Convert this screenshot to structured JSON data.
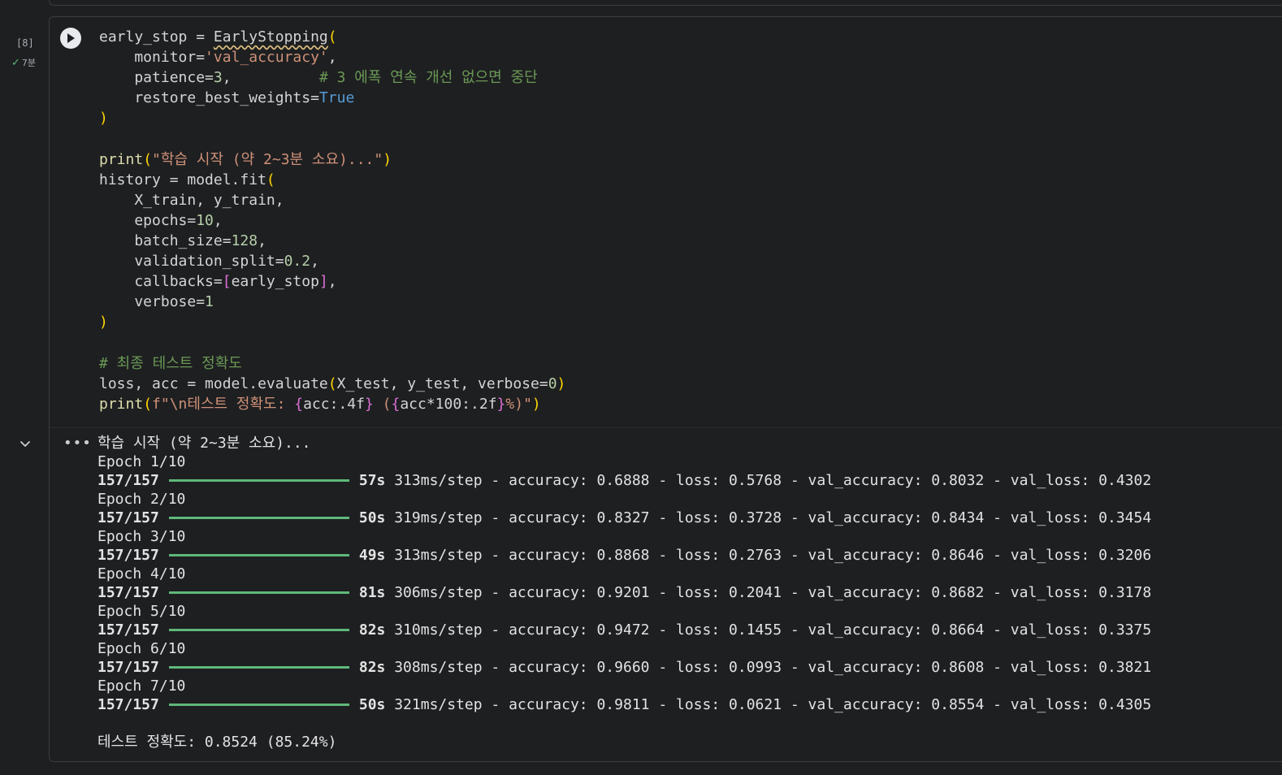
{
  "cell": {
    "execution_count": "[8]",
    "status_time": "7분"
  },
  "code_lines": [
    [
      {
        "t": "early_stop = "
      },
      {
        "t": "EarlyStopping",
        "c": "cls"
      },
      {
        "t": "(",
        "c": "br"
      }
    ],
    [
      {
        "t": "    monitor="
      },
      {
        "t": "'val_accuracy'",
        "c": "str"
      },
      {
        "t": ","
      }
    ],
    [
      {
        "t": "    patience="
      },
      {
        "t": "3",
        "c": "num"
      },
      {
        "t": ",          "
      },
      {
        "t": "# 3 에폭 연속 개선 없으면 중단",
        "c": "cm"
      }
    ],
    [
      {
        "t": "    restore_best_weights="
      },
      {
        "t": "True",
        "c": "kw"
      }
    ],
    [
      {
        "t": ")",
        "c": "br"
      }
    ],
    [
      {
        "t": ""
      }
    ],
    [
      {
        "t": "print",
        "c": "fn"
      },
      {
        "t": "(",
        "c": "br"
      },
      {
        "t": "\"학습 시작 (약 2~3분 소요)...\"",
        "c": "str"
      },
      {
        "t": ")",
        "c": "br"
      }
    ],
    [
      {
        "t": "history = model.fit"
      },
      {
        "t": "(",
        "c": "br"
      }
    ],
    [
      {
        "t": "    X_train, y_train,"
      }
    ],
    [
      {
        "t": "    epochs="
      },
      {
        "t": "10",
        "c": "num"
      },
      {
        "t": ","
      }
    ],
    [
      {
        "t": "    batch_size="
      },
      {
        "t": "128",
        "c": "num"
      },
      {
        "t": ","
      }
    ],
    [
      {
        "t": "    validation_split="
      },
      {
        "t": "0.2",
        "c": "num"
      },
      {
        "t": ","
      }
    ],
    [
      {
        "t": "    callbacks="
      },
      {
        "t": "[",
        "c": "br2"
      },
      {
        "t": "early_stop"
      },
      {
        "t": "]",
        "c": "br2"
      },
      {
        "t": ","
      }
    ],
    [
      {
        "t": "    verbose="
      },
      {
        "t": "1",
        "c": "num"
      }
    ],
    [
      {
        "t": ")",
        "c": "br"
      }
    ],
    [
      {
        "t": ""
      }
    ],
    [
      {
        "t": "# 최종 테스트 정확도",
        "c": "cm"
      }
    ],
    [
      {
        "t": "loss, acc = model.evaluate"
      },
      {
        "t": "(",
        "c": "br"
      },
      {
        "t": "X_test, y_test, verbose="
      },
      {
        "t": "0",
        "c": "num"
      },
      {
        "t": ")",
        "c": "br"
      }
    ],
    [
      {
        "t": "print",
        "c": "fn"
      },
      {
        "t": "(",
        "c": "br"
      },
      {
        "t": "f\"\\n테스트 정확도: ",
        "c": "str"
      },
      {
        "t": "{",
        "c": "br2"
      },
      {
        "t": "acc:.4f"
      },
      {
        "t": "}",
        "c": "br2"
      },
      {
        "t": " (",
        "c": "str"
      },
      {
        "t": "{",
        "c": "br2"
      },
      {
        "t": "acc*100:.2f"
      },
      {
        "t": "}",
        "c": "br2"
      },
      {
        "t": "%)\"",
        "c": "str"
      },
      {
        "t": ")",
        "c": "br"
      }
    ]
  ],
  "output": {
    "header": "학습 시작 (약 2~3분 소요)...",
    "epochs": [
      {
        "epoch": "Epoch 1/10",
        "steps": "157/157",
        "time": "57s",
        "rest": "313ms/step - accuracy: 0.6888 - loss: 0.5768 - val_accuracy: 0.8032 - val_loss: 0.4302"
      },
      {
        "epoch": "Epoch 2/10",
        "steps": "157/157",
        "time": "50s",
        "rest": "319ms/step - accuracy: 0.8327 - loss: 0.3728 - val_accuracy: 0.8434 - val_loss: 0.3454"
      },
      {
        "epoch": "Epoch 3/10",
        "steps": "157/157",
        "time": "49s",
        "rest": "313ms/step - accuracy: 0.8868 - loss: 0.2763 - val_accuracy: 0.8646 - val_loss: 0.3206"
      },
      {
        "epoch": "Epoch 4/10",
        "steps": "157/157",
        "time": "81s",
        "rest": "306ms/step - accuracy: 0.9201 - loss: 0.2041 - val_accuracy: 0.8682 - val_loss: 0.3178"
      },
      {
        "epoch": "Epoch 5/10",
        "steps": "157/157",
        "time": "82s",
        "rest": "310ms/step - accuracy: 0.9472 - loss: 0.1455 - val_accuracy: 0.8664 - val_loss: 0.3375"
      },
      {
        "epoch": "Epoch 6/10",
        "steps": "157/157",
        "time": "82s",
        "rest": "308ms/step - accuracy: 0.9660 - loss: 0.0993 - val_accuracy: 0.8608 - val_loss: 0.3821"
      },
      {
        "epoch": "Epoch 7/10",
        "steps": "157/157",
        "time": "50s",
        "rest": "321ms/step - accuracy: 0.9811 - loss: 0.0621 - val_accuracy: 0.8554 - val_loss: 0.4305"
      }
    ],
    "result": "테스트 정확도: 0.8524 (85.24%)"
  },
  "icons": {
    "run": "play-icon",
    "status": "check-icon",
    "collapse": "chevron-down-icon",
    "output_menu": "ellipsis-icon"
  },
  "colors": {
    "background": "#1e1f21",
    "progress_bar": "#5fb87a",
    "string": "#ce9178",
    "number": "#b5cea8",
    "keyword": "#569cd6",
    "comment": "#6a9955"
  }
}
